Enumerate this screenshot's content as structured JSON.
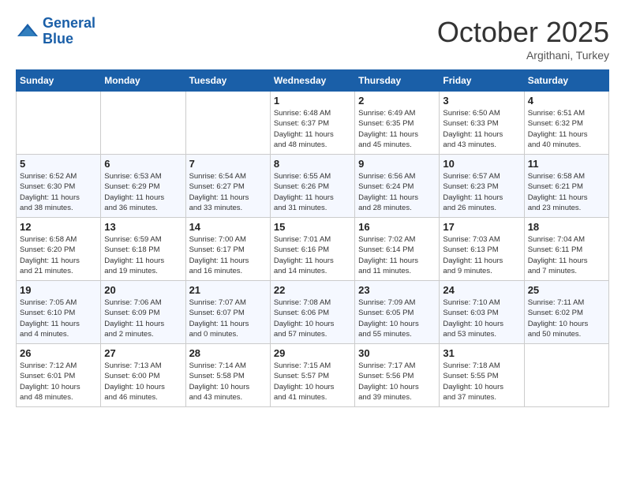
{
  "header": {
    "logo_line1": "General",
    "logo_line2": "Blue",
    "month": "October 2025",
    "location": "Argithani, Turkey"
  },
  "days_of_week": [
    "Sunday",
    "Monday",
    "Tuesday",
    "Wednesday",
    "Thursday",
    "Friday",
    "Saturday"
  ],
  "weeks": [
    [
      {
        "day": "",
        "info": ""
      },
      {
        "day": "",
        "info": ""
      },
      {
        "day": "",
        "info": ""
      },
      {
        "day": "1",
        "info": "Sunrise: 6:48 AM\nSunset: 6:37 PM\nDaylight: 11 hours\nand 48 minutes."
      },
      {
        "day": "2",
        "info": "Sunrise: 6:49 AM\nSunset: 6:35 PM\nDaylight: 11 hours\nand 45 minutes."
      },
      {
        "day": "3",
        "info": "Sunrise: 6:50 AM\nSunset: 6:33 PM\nDaylight: 11 hours\nand 43 minutes."
      },
      {
        "day": "4",
        "info": "Sunrise: 6:51 AM\nSunset: 6:32 PM\nDaylight: 11 hours\nand 40 minutes."
      }
    ],
    [
      {
        "day": "5",
        "info": "Sunrise: 6:52 AM\nSunset: 6:30 PM\nDaylight: 11 hours\nand 38 minutes."
      },
      {
        "day": "6",
        "info": "Sunrise: 6:53 AM\nSunset: 6:29 PM\nDaylight: 11 hours\nand 36 minutes."
      },
      {
        "day": "7",
        "info": "Sunrise: 6:54 AM\nSunset: 6:27 PM\nDaylight: 11 hours\nand 33 minutes."
      },
      {
        "day": "8",
        "info": "Sunrise: 6:55 AM\nSunset: 6:26 PM\nDaylight: 11 hours\nand 31 minutes."
      },
      {
        "day": "9",
        "info": "Sunrise: 6:56 AM\nSunset: 6:24 PM\nDaylight: 11 hours\nand 28 minutes."
      },
      {
        "day": "10",
        "info": "Sunrise: 6:57 AM\nSunset: 6:23 PM\nDaylight: 11 hours\nand 26 minutes."
      },
      {
        "day": "11",
        "info": "Sunrise: 6:58 AM\nSunset: 6:21 PM\nDaylight: 11 hours\nand 23 minutes."
      }
    ],
    [
      {
        "day": "12",
        "info": "Sunrise: 6:58 AM\nSunset: 6:20 PM\nDaylight: 11 hours\nand 21 minutes."
      },
      {
        "day": "13",
        "info": "Sunrise: 6:59 AM\nSunset: 6:18 PM\nDaylight: 11 hours\nand 19 minutes."
      },
      {
        "day": "14",
        "info": "Sunrise: 7:00 AM\nSunset: 6:17 PM\nDaylight: 11 hours\nand 16 minutes."
      },
      {
        "day": "15",
        "info": "Sunrise: 7:01 AM\nSunset: 6:16 PM\nDaylight: 11 hours\nand 14 minutes."
      },
      {
        "day": "16",
        "info": "Sunrise: 7:02 AM\nSunset: 6:14 PM\nDaylight: 11 hours\nand 11 minutes."
      },
      {
        "day": "17",
        "info": "Sunrise: 7:03 AM\nSunset: 6:13 PM\nDaylight: 11 hours\nand 9 minutes."
      },
      {
        "day": "18",
        "info": "Sunrise: 7:04 AM\nSunset: 6:11 PM\nDaylight: 11 hours\nand 7 minutes."
      }
    ],
    [
      {
        "day": "19",
        "info": "Sunrise: 7:05 AM\nSunset: 6:10 PM\nDaylight: 11 hours\nand 4 minutes."
      },
      {
        "day": "20",
        "info": "Sunrise: 7:06 AM\nSunset: 6:09 PM\nDaylight: 11 hours\nand 2 minutes."
      },
      {
        "day": "21",
        "info": "Sunrise: 7:07 AM\nSunset: 6:07 PM\nDaylight: 11 hours\nand 0 minutes."
      },
      {
        "day": "22",
        "info": "Sunrise: 7:08 AM\nSunset: 6:06 PM\nDaylight: 10 hours\nand 57 minutes."
      },
      {
        "day": "23",
        "info": "Sunrise: 7:09 AM\nSunset: 6:05 PM\nDaylight: 10 hours\nand 55 minutes."
      },
      {
        "day": "24",
        "info": "Sunrise: 7:10 AM\nSunset: 6:03 PM\nDaylight: 10 hours\nand 53 minutes."
      },
      {
        "day": "25",
        "info": "Sunrise: 7:11 AM\nSunset: 6:02 PM\nDaylight: 10 hours\nand 50 minutes."
      }
    ],
    [
      {
        "day": "26",
        "info": "Sunrise: 7:12 AM\nSunset: 6:01 PM\nDaylight: 10 hours\nand 48 minutes."
      },
      {
        "day": "27",
        "info": "Sunrise: 7:13 AM\nSunset: 6:00 PM\nDaylight: 10 hours\nand 46 minutes."
      },
      {
        "day": "28",
        "info": "Sunrise: 7:14 AM\nSunset: 5:58 PM\nDaylight: 10 hours\nand 43 minutes."
      },
      {
        "day": "29",
        "info": "Sunrise: 7:15 AM\nSunset: 5:57 PM\nDaylight: 10 hours\nand 41 minutes."
      },
      {
        "day": "30",
        "info": "Sunrise: 7:17 AM\nSunset: 5:56 PM\nDaylight: 10 hours\nand 39 minutes."
      },
      {
        "day": "31",
        "info": "Sunrise: 7:18 AM\nSunset: 5:55 PM\nDaylight: 10 hours\nand 37 minutes."
      },
      {
        "day": "",
        "info": ""
      }
    ]
  ]
}
